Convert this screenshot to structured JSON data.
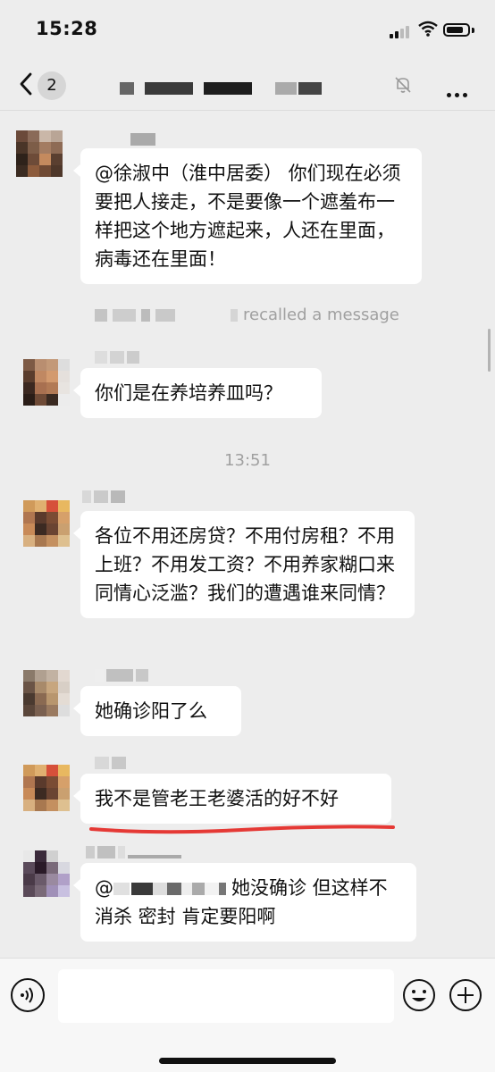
{
  "status": {
    "time": "15:28"
  },
  "nav": {
    "unread_count": "2"
  },
  "messages": [
    {
      "text": "@徐淑中（淮中居委） 你们现在必须要把人接走，不是要像一个遮羞布一样把这个地方遮起来，人还在里面，病毒还在里面！"
    },
    {
      "text": "你们是在养培养皿吗？"
    },
    {
      "text": "各位不用还房贷？不用付房租？不用上班？不用发工资？不用养家糊口来同情心泛滥？我们的遭遇谁来同情？"
    },
    {
      "text": "她确诊阳了么"
    },
    {
      "text": "我不是管老王老婆活的好不好"
    },
    {
      "text_prefix": "@",
      "text_suffix": "她没确诊 但这样不消杀 密封 肯定要阳啊"
    }
  ],
  "system": {
    "recalled": "recalled a message"
  },
  "timestamp": "13:51",
  "colors": {
    "background": "#ededed",
    "bubble": "#ffffff",
    "underline": "#e53935"
  },
  "icons": [
    "back-arrow-icon",
    "mute-bell-icon",
    "more-dots-icon",
    "voice-icon",
    "emoji-icon",
    "plus-icon"
  ]
}
